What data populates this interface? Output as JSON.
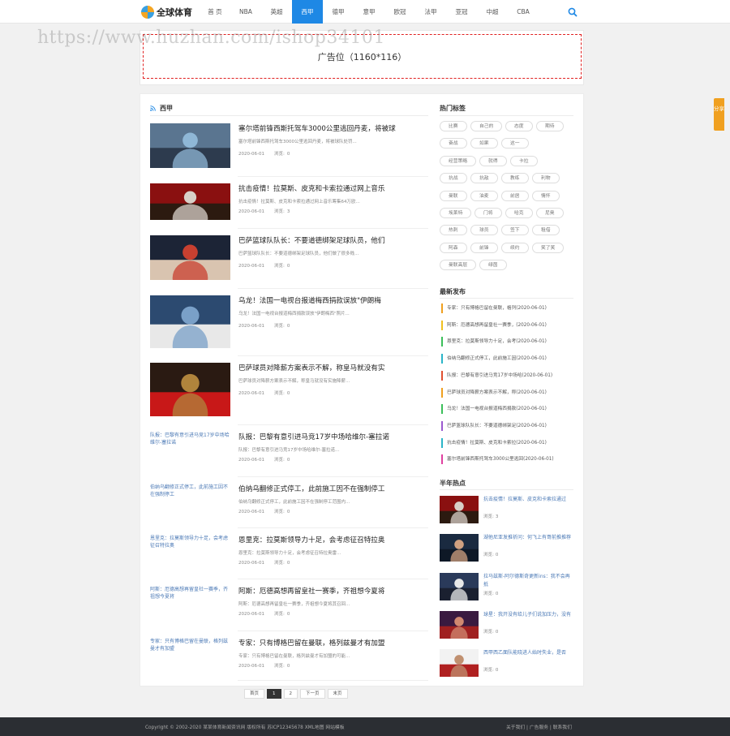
{
  "header": {
    "logo_text": "全球体育",
    "nav": [
      "首 页",
      "NBA",
      "英超",
      "西甲",
      "德甲",
      "意甲",
      "欧冠",
      "法甲",
      "亚冠",
      "中超",
      "CBA"
    ],
    "active_nav": "西甲",
    "accent_color": "#1e88e5",
    "search_icon": "search-icon"
  },
  "watermark": "https://www.huzhan.com/ishop34101",
  "ad": {
    "label": "广告位（1160*116）"
  },
  "section": {
    "title": "西甲",
    "icon": "rss-icon"
  },
  "articles": [
    {
      "title": "塞尔塔前锋西斯托驾车3000公里逃回丹麦，将被球",
      "summary": "塞尔塔前锋西斯托驾车3000公里逃回丹麦，将被球队处罚...",
      "date": "2020-06-01",
      "views_label": "浏览:",
      "views": "0",
      "image": "photo"
    },
    {
      "title": "抗击疫情！拉莫斯、皮克和卡索拉通过网上音乐",
      "summary": "抗击疫情！拉莫斯、皮克和卡索拉通过网上音乐筹集64万欧...",
      "date": "2020-06-01",
      "views_label": "浏览:",
      "views": "3",
      "image": "photo"
    },
    {
      "title": "巴萨篮球队队长：不要道德绑架足球队员，他们",
      "summary": "巴萨篮球队队长：不要道德绑架足球队员，他们做了很多贱...",
      "date": "2020-06-01",
      "views_label": "浏览:",
      "views": "0",
      "image": "photo"
    },
    {
      "title": "乌龙！法国一电视台报道梅西捐款误放\"伊朗梅",
      "summary": "乌龙！法国一电视台报道梅西捐款误放\"伊朗梅西\"照片...",
      "date": "2020-06-01",
      "views_label": "浏览:",
      "views": "0",
      "image": "photo"
    },
    {
      "title": "巴萨球员对降薪方案表示不解，称皇马就没有实",
      "summary": "巴萨球员对降薪方案表示不解，称皇马就没有实施降薪...",
      "date": "2020-06-01",
      "views_label": "浏览:",
      "views": "0",
      "image": "photo"
    },
    {
      "title": "队报：巴黎有意引进马竞17岁中场哈维尔-塞拉诺",
      "summary": "队报：巴黎有意引进马竞17岁中场哈维尔-塞拉诺...",
      "date": "2020-06-01",
      "views_label": "浏览:",
      "views": "0",
      "image": "broken",
      "alt": "队报：巴黎有意引进马竞17岁中场哈维尔-塞拉诺"
    },
    {
      "title": "伯纳乌翻修正式停工，此前施工因不在强制停工",
      "summary": "伯纳乌翻修正式停工，此前施工因不在强制停工范围内...",
      "date": "2020-06-01",
      "views_label": "浏览:",
      "views": "0",
      "image": "broken",
      "alt": "伯纳乌翻修正式停工，此前施工因不在强制停工"
    },
    {
      "title": "恩里克：拉莫斯领导力十足，会考虑征召特拉奥",
      "summary": "恩里克：拉莫斯领导力十足，会考虑征召特拉奥雷...",
      "date": "2020-06-01",
      "views_label": "浏览:",
      "views": "0",
      "image": "broken",
      "alt": "恩里克：拉莫斯领导力十足，会考虑征召特拉奥"
    },
    {
      "title": "阿斯：厄德高想再留皇社一赛季，齐祖想今夏将",
      "summary": "阿斯：厄德高想再留皇社一赛季，齐祖想今夏将其召回...",
      "date": "2020-06-01",
      "views_label": "浏览:",
      "views": "0",
      "image": "broken",
      "alt": "阿斯：厄德高想再留皇社一赛季，齐祖想今夏将"
    },
    {
      "title": "专家：只有博格巴留在曼联，格列兹曼才有加盟",
      "summary": "专家：只有博格巴留在曼联，格列兹曼才有加盟的可能...",
      "date": "2020-06-01",
      "views_label": "浏览:",
      "views": "0",
      "image": "broken",
      "alt": "专家：只有博格巴留在曼联，格列兹曼才有加盟"
    }
  ],
  "pagination": [
    "首页",
    "1",
    "2",
    "下一页",
    "末页"
  ],
  "pagination_current": "1",
  "sidebar": {
    "tags_title": "热门标签",
    "tags": [
      "比赛",
      "自己的",
      "态度",
      "期待",
      "奋战",
      "如果",
      "这一",
      "经营策略",
      "就得",
      "卡拉",
      "抗战",
      "抗敌",
      "教练",
      "利物",
      "曼联",
      "油麦",
      "前居",
      "情怀",
      "埃莱特",
      "门将",
      "哈克",
      "尼奥",
      "热刺",
      "球员",
      "签下",
      "租借",
      "阿森",
      "前锋",
      "续约",
      "笑了笑",
      "曼联高层",
      "绿茵"
    ],
    "recent_title": "最新发布",
    "recent": [
      {
        "text": "专家：只有博格巴留在曼联，格列(2020-06-01)",
        "color": "#f0a020"
      },
      {
        "text": "阿斯：厄德高想再留皇社一赛季，(2020-06-01)",
        "color": "#f0c020"
      },
      {
        "text": "恩里克：拉莫斯领导力十足，会考(2020-06-01)",
        "color": "#3bbf5a"
      },
      {
        "text": "伯纳乌翻修正式停工，此前施工因(2020-06-01)",
        "color": "#2bb5c8"
      },
      {
        "text": "队报：巴黎有意引进马竞17岁中场哈(2020-06-01)",
        "color": "#e05030"
      },
      {
        "text": "巴萨球员对降薪方案表示不解，称(2020-06-01)",
        "color": "#f0a020"
      },
      {
        "text": "乌龙！法国一电视台报道梅西捐款(2020-06-01)",
        "color": "#3bbf5a"
      },
      {
        "text": "巴萨篮球队队长：不要道德绑架足(2020-06-01)",
        "color": "#9b59d0"
      },
      {
        "text": "抗击疫情！拉莫斯、皮克和卡索拉(2020-06-01)",
        "color": "#2bb5c8"
      },
      {
        "text": "塞尔塔前锋西斯托驾车3000公里逃回(2020-06-01)",
        "color": "#e040a0"
      }
    ],
    "hot_title": "半年热点",
    "hot": [
      {
        "title": "抗击疫情！拉莫斯、皮克和卡索拉通过",
        "views_label": "浏览:",
        "views": "3"
      },
      {
        "title": "湖他尼亚发推祈问：何飞上有哥前推推荐",
        "views_label": "浏览:",
        "views": "0"
      },
      {
        "title": "拉马兹斯-阿尔德斯奇更新ins：我不会再抵",
        "views_label": "浏览:",
        "views": "0"
      },
      {
        "title": "球星：我开没有给儿子们说加压力，没有",
        "views_label": "浏览:",
        "views": "0"
      },
      {
        "title": "西甲西乙面队能晓进人始时失业，是否",
        "views_label": "浏览:",
        "views": "0"
      }
    ]
  },
  "float_button": "分享",
  "footer": {
    "copyright": "Copyright © 2002-2020 某某体育新闻资讯网 版权所有 苏ICP12345678 XML地图 网站模板",
    "links": [
      "关于我们",
      "广告服务",
      "联系我们"
    ]
  }
}
